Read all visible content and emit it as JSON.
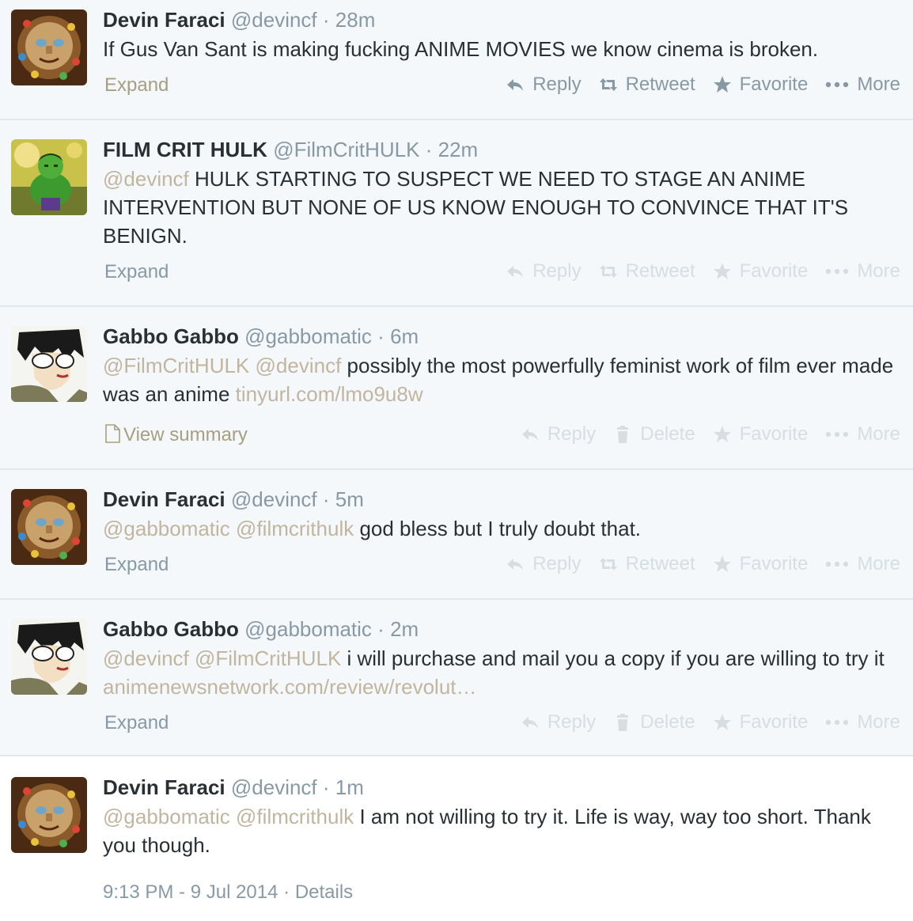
{
  "tweets": [
    {
      "name": "Devin Faraci",
      "handle": "@devincf",
      "sep": "·",
      "time": "28m",
      "segments": [
        {
          "type": "text",
          "value": "If Gus Van Sant is making fucking ANIME MOVIES we know cinema is broken."
        }
      ],
      "expand_label": "Expand",
      "actions": [
        "Reply",
        "Retweet",
        "Favorite",
        "More"
      ]
    },
    {
      "name": "FILM CRIT HULK",
      "handle": "@FilmCritHULK",
      "sep": "·",
      "time": "22m",
      "segments": [
        {
          "type": "mention",
          "value": "@devincf"
        },
        {
          "type": "text",
          "value": " HULK STARTING TO SUSPECT WE NEED TO STAGE AN ANIME INTERVENTION BUT NONE OF US KNOW ENOUGH TO CONVINCE THAT IT'S BENIGN."
        }
      ],
      "expand_label": "Expand",
      "actions": [
        "Reply",
        "Retweet",
        "Favorite",
        "More"
      ]
    },
    {
      "name": "Gabbo Gabbo",
      "handle": "@gabbomatic",
      "sep": "·",
      "time": "6m",
      "segments": [
        {
          "type": "mention",
          "value": "@FilmCritHULK"
        },
        {
          "type": "text",
          "value": " "
        },
        {
          "type": "mention",
          "value": "@devincf"
        },
        {
          "type": "text",
          "value": " possibly the most powerfully feminist work of film ever made was an anime "
        },
        {
          "type": "link",
          "value": "tinyurl.com/lmo9u8w"
        }
      ],
      "expand_label": "View summary",
      "actions": [
        "Reply",
        "Delete",
        "Favorite",
        "More"
      ]
    },
    {
      "name": "Devin Faraci",
      "handle": "@devincf",
      "sep": "·",
      "time": "5m",
      "segments": [
        {
          "type": "mention",
          "value": "@gabbomatic"
        },
        {
          "type": "text",
          "value": " "
        },
        {
          "type": "mention",
          "value": "@filmcrithulk"
        },
        {
          "type": "text",
          "value": " god bless but I truly doubt that."
        }
      ],
      "expand_label": "Expand",
      "actions": [
        "Reply",
        "Retweet",
        "Favorite",
        "More"
      ]
    },
    {
      "name": "Gabbo Gabbo",
      "handle": "@gabbomatic",
      "sep": "·",
      "time": "2m",
      "segments": [
        {
          "type": "mention",
          "value": "@devincf"
        },
        {
          "type": "text",
          "value": " "
        },
        {
          "type": "mention",
          "value": "@FilmCritHULK"
        },
        {
          "type": "text",
          "value": " i will purchase and mail you a copy if you are willing to try it "
        },
        {
          "type": "link",
          "value": "animenewsnetwork.com/review/revolut…"
        }
      ],
      "expand_label": "Expand",
      "actions": [
        "Reply",
        "Delete",
        "Favorite",
        "More"
      ]
    },
    {
      "name": "Devin Faraci",
      "handle": "@devincf",
      "sep": "·",
      "time": "1m",
      "segments": [
        {
          "type": "mention",
          "value": "@gabbomatic"
        },
        {
          "type": "text",
          "value": " "
        },
        {
          "type": "mention",
          "value": "@filmcrithulk"
        },
        {
          "type": "text",
          "value": " I am not willing to try it. Life is way, way too short. Thank you though."
        }
      ]
    }
  ],
  "footer": {
    "timestamp": "9:13 PM - 9 Jul 2014",
    "sep": "·",
    "details_label": "Details"
  },
  "colors": {
    "mention": "#c1b59f",
    "secondary": "#8899a6",
    "faded_action": "#d8dde2"
  },
  "icons": {
    "Reply": "reply-icon",
    "Retweet": "retweet-icon",
    "Delete": "trash-icon",
    "Favorite": "star-icon",
    "More": "ellipsis-icon"
  }
}
